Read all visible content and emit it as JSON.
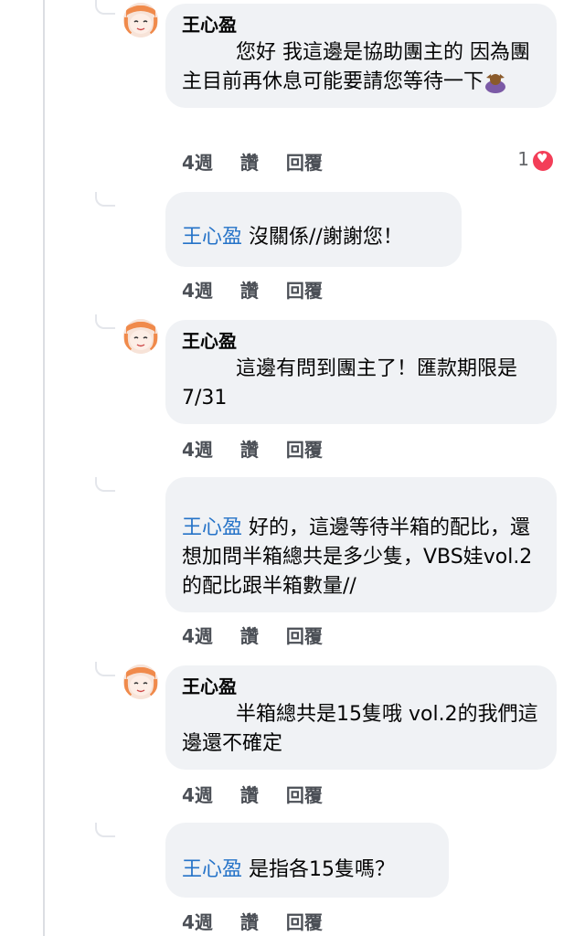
{
  "comments": [
    {
      "author": "王心盈",
      "text": "您好 我這邊是協助團主的 因為團主目前再休息可能要請您等待一下",
      "time": "4週",
      "like": "讚",
      "reply": "回覆",
      "reaction_count": "1",
      "reaction_icon": "heart-icon"
    },
    {
      "tag": "王心盈",
      "text": "沒關係//謝謝您！",
      "time": "4週",
      "like": "讚",
      "reply": "回覆"
    },
    {
      "author": "王心盈",
      "text": "這邊有問到團主了！匯款期限是7/31",
      "time": "4週",
      "like": "讚",
      "reply": "回覆"
    },
    {
      "tag": "王心盈",
      "text": "好的，這邊等待半箱的配比，還想加問半箱總共是多少隻，VBS娃vol.2的配比跟半箱數量//",
      "time": "4週",
      "like": "讚",
      "reply": "回覆"
    },
    {
      "author": "王心盈",
      "text": "半箱總共是15隻哦 vol.2的我們這邊還不確定",
      "time": "4週",
      "like": "讚",
      "reply": "回覆"
    },
    {
      "tag": "王心盈",
      "text": "是指各15隻嗎？",
      "time": "4週",
      "like": "讚",
      "reply": "回覆"
    }
  ]
}
